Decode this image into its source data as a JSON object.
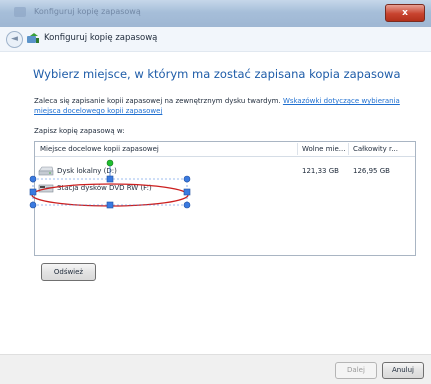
{
  "window": {
    "titlebar_text": "Konfiguruj kopię zapasową",
    "close_label": "x",
    "back_glyph": "◄"
  },
  "nav": {
    "title": "Konfiguruj kopię zapasową"
  },
  "main": {
    "headline": "Wybierz miejsce, w którym ma zostać zapisana kopia zapasowa",
    "description": "Zaleca się zapisanie kopii zapasowej na zewnętrznym dysku twardym.",
    "help_link": "Wskazówki dotyczące wybierania miejsca docelowego kopii zapasowej",
    "list_label": "Zapisz kopię zapasową w:",
    "columns": [
      "Miejsce docelowe kopii zapasowej",
      "Wolne mie...",
      "Całkowity r..."
    ],
    "rows": [
      {
        "name": "Dysk lokalny (D:)",
        "free": "121,33 GB",
        "total": "126,95 GB",
        "icon": "hard-drive-icon"
      },
      {
        "name": "Stacja dysków DVD RW (F:)",
        "free": "",
        "total": "",
        "icon": "dvd-drive-icon"
      }
    ],
    "refresh_label": "Odśwież"
  },
  "footer": {
    "next_label": "Dalej",
    "cancel_label": "Anuluj"
  },
  "colors": {
    "headline": "#1e5ca8",
    "link": "#1f6fd0",
    "annotation": "#cc1f1f",
    "handle": "#3a7ae0",
    "rotate_handle": "#1fbf2f"
  }
}
